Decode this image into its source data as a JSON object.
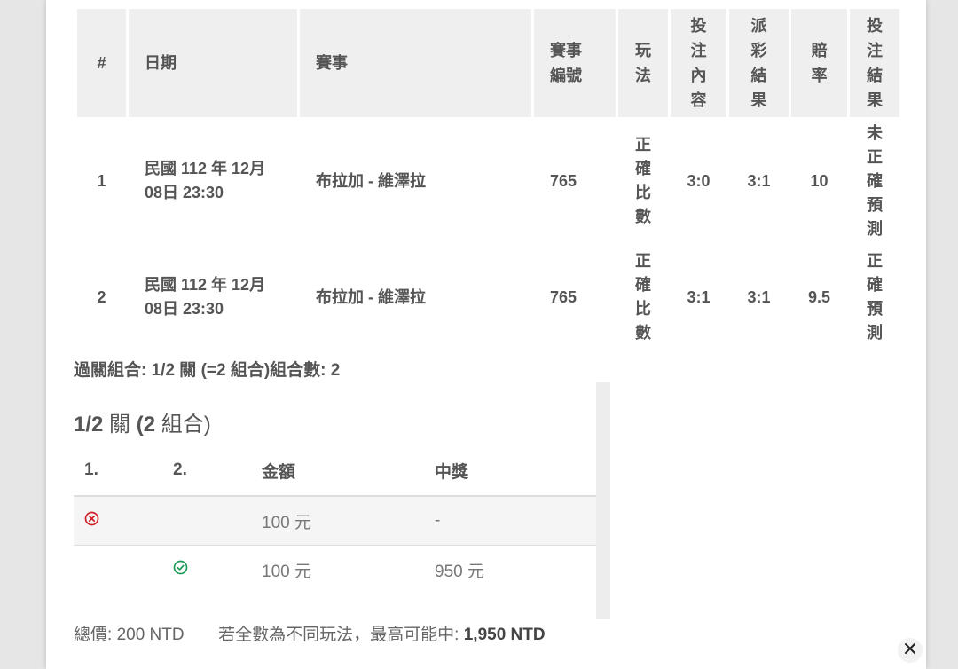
{
  "bet_table": {
    "headers": {
      "index": "#",
      "date": "日期",
      "match": "賽事",
      "match_no": "賽事編號",
      "play": "玩法",
      "bet_content": "投注內容",
      "result": "派彩結果",
      "odds": "賠率",
      "bet_result": "投注結果"
    },
    "rows": [
      {
        "index": "1",
        "date": "民國 112 年 12月 08日 23:30",
        "match": "布拉加 - 維澤拉",
        "match_no": "765",
        "play": "正確比數",
        "bet_content": "3:0",
        "result": "3:1",
        "odds": "10",
        "bet_result": "未正確預測"
      },
      {
        "index": "2",
        "date": "民國 112 年 12月 08日 23:30",
        "match": "布拉加 - 維澤拉",
        "match_no": "765",
        "play": "正確比數",
        "bet_content": "3:1",
        "result": "3:1",
        "odds": "9.5",
        "bet_result": "正確預測"
      }
    ]
  },
  "combo_summary": "過關組合: 1/2 關 (=2 組合)組合數: 2",
  "combo": {
    "title_a": "1/2",
    "title_b": " 關 ",
    "title_c": "(2",
    "title_d": " 組合)",
    "headers": {
      "c1": "1.",
      "c2": "2.",
      "amount": "金額",
      "prize": "中獎"
    },
    "rows": [
      {
        "amount": "100 元",
        "prize": "-"
      },
      {
        "amount": "100 元",
        "prize": "950 元"
      }
    ]
  },
  "footer": {
    "total_label": "總價:",
    "total_value": "200 NTD",
    "max_label": "若全數為不同玩法，最高可能中:",
    "max_value": "1,950 NTD"
  },
  "icons": {
    "fail": "x-circle-icon",
    "success": "check-circle-icon",
    "close": "close-icon"
  },
  "colors": {
    "fail": "#d0202a",
    "success": "#1e9a55"
  }
}
